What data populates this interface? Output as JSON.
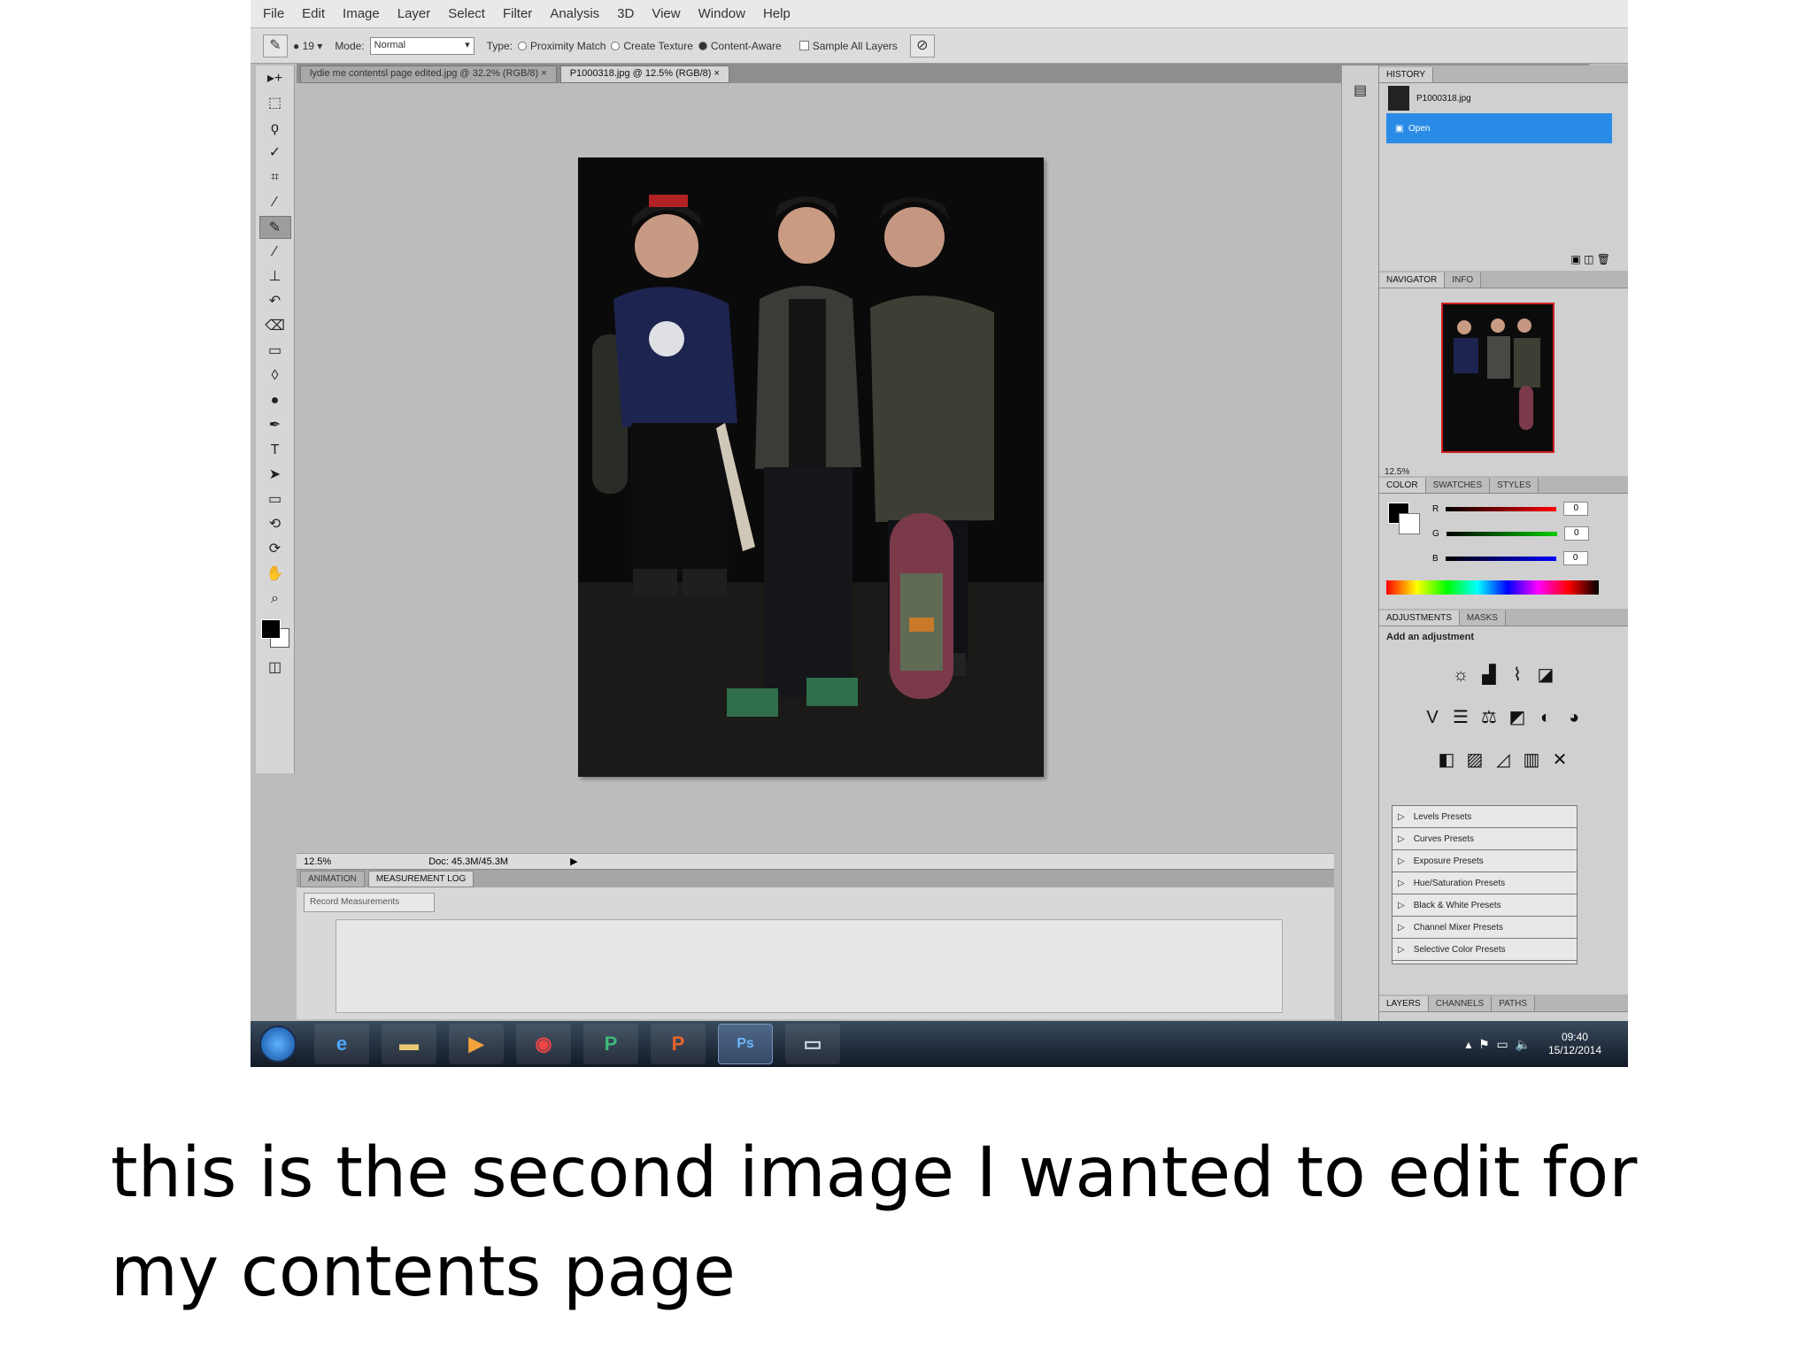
{
  "menu": [
    "File",
    "Edit",
    "Image",
    "Layer",
    "Select",
    "Filter",
    "Analysis",
    "3D",
    "View",
    "Window",
    "Help"
  ],
  "options": {
    "mode_label": "Mode:",
    "mode_value": "Normal",
    "type_label": "Type:",
    "proximity": "Proximity Match",
    "create_texture": "Create Texture",
    "content_aware": "Content-Aware",
    "sample_all": "Sample All Layers",
    "brush_size": "19"
  },
  "doc_tabs": [
    "lydie me contentsl page edited.jpg @ 32.2% (RGB/8)",
    "P1000318.jpg @ 12.5% (RGB/8)"
  ],
  "status": {
    "zoom": "12.5%",
    "doc": "Doc: 45.3M/45.3M"
  },
  "bottom_panel": {
    "tabs": [
      "ANIMATION",
      "MEASUREMENT LOG"
    ],
    "record_button": "Record Measurements"
  },
  "history": {
    "title": "HISTORY",
    "file": "P1000318.jpg",
    "step": "Open"
  },
  "navigator": {
    "tabs": [
      "NAVIGATOR",
      "INFO"
    ],
    "zoom": "12.5%"
  },
  "color": {
    "tabs": [
      "COLOR",
      "SWATCHES",
      "STYLES"
    ],
    "r_label": "R",
    "g_label": "G",
    "b_label": "B",
    "r": "0",
    "g": "0",
    "b": "0"
  },
  "adjustments": {
    "tabs": [
      "ADJUSTMENTS",
      "MASKS"
    ],
    "title": "Add an adjustment",
    "presets": [
      "Levels Presets",
      "Curves Presets",
      "Exposure Presets",
      "Hue/Saturation Presets",
      "Black & White Presets",
      "Channel Mixer Presets",
      "Selective Color Presets"
    ]
  },
  "layers_tabs": [
    "LAYERS",
    "CHANNELS",
    "PATHS"
  ],
  "taskbar": {
    "time": "09:40",
    "date": "15/12/2014",
    "photoshop_label": "Ps"
  },
  "caption": "this is the second image I wanted to edit for my contents page"
}
